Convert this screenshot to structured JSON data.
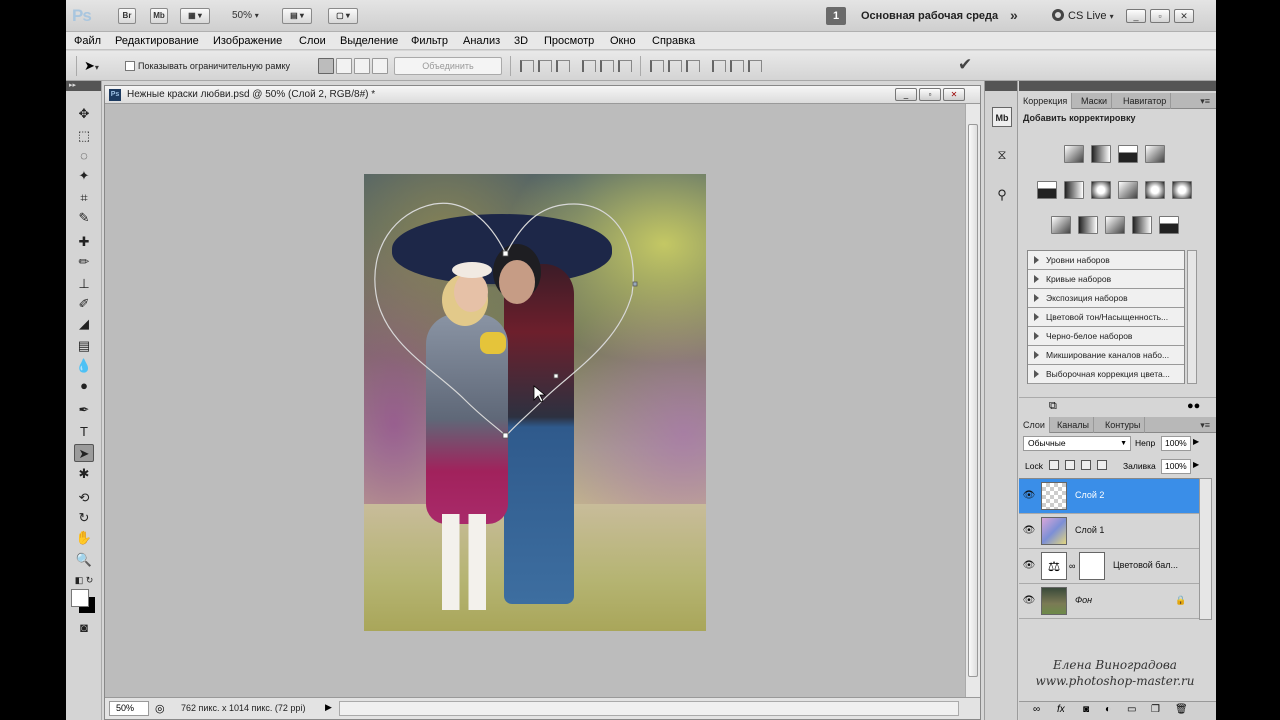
{
  "app": {
    "logo": "Ps",
    "bridge": "Br",
    "minibridge": "Mb",
    "zoom": "50%",
    "workspace_number": "1",
    "workspace": "Основная рабочая среда",
    "more": "»",
    "cslive": "CS Live",
    "minimize": "_",
    "restore": "▫",
    "close": "✕"
  },
  "menu": [
    "Файл",
    "Редактирование",
    "Изображение",
    "Слои",
    "Выделение",
    "Фильтр",
    "Анализ",
    "3D",
    "Просмотр",
    "Окно",
    "Справка"
  ],
  "options": {
    "bbox_label": "Показывать ограничительную рамку",
    "combine": "Объединить",
    "commit": "✔"
  },
  "document": {
    "title": "Нежные краски любви.psd @ 50% (Слой 2, RGB/8#) *",
    "icon": "Ps",
    "zoom": "50%",
    "info": "762 пикс. x 1014 пикс. (72 ppi)"
  },
  "adjustments": {
    "tabs": [
      "Коррекция",
      "Маски",
      "Навигатор"
    ],
    "title": "Добавить корректировку",
    "presets": [
      "Уровни наборов",
      "Кривые наборов",
      "Экспозиция наборов",
      "Цветовой тон/Насыщенность...",
      "Черно-белое наборов",
      "Микширование каналов набо...",
      "Выборочная коррекция цвета..."
    ]
  },
  "layers": {
    "tabs": [
      "Слои",
      "Каналы",
      "Контуры"
    ],
    "blend_mode": "Обычные",
    "opacity_label": "Непр",
    "opacity": "100%",
    "lock_label": "Lock",
    "fill_label": "Заливка",
    "fill": "100%",
    "items": [
      {
        "name": "Слой 2",
        "selected": true
      },
      {
        "name": "Слой 1",
        "selected": false
      },
      {
        "name": "Цветовой бал...",
        "selected": false
      },
      {
        "name": "Фон",
        "selected": false
      }
    ]
  },
  "watermark": {
    "line1": "Елена Виноградова",
    "line2": "www.photoshop-master.ru"
  },
  "colors": {
    "selection": "#3a8ee8",
    "panel": "#d6d6d6",
    "canvas": "#bcbcbc"
  }
}
